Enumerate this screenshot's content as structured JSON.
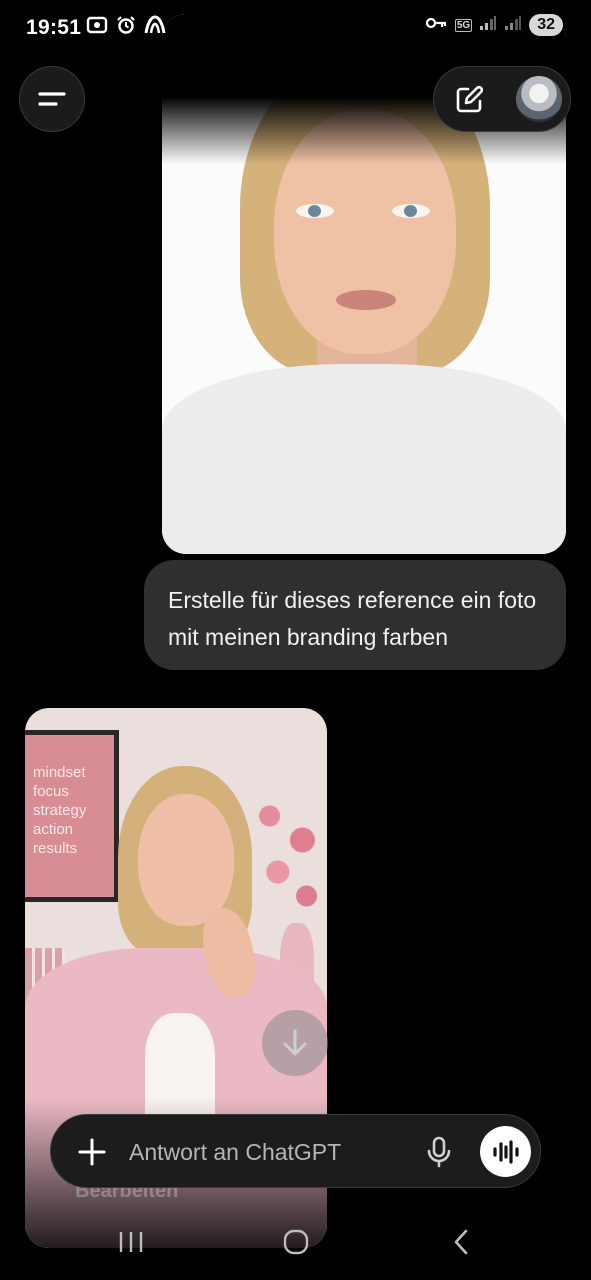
{
  "status_bar": {
    "time": "19:51",
    "network_label": "5G",
    "battery": "32",
    "left_icons": [
      "screen-recorder-icon",
      "alarm-icon",
      "app-notification-icon"
    ],
    "right_icons": [
      "vpn-key-icon",
      "network-5g-icon",
      "signal-icon",
      "signal-icon-2"
    ]
  },
  "header": {
    "menu_icon": "menu-icon",
    "edit_icon": "new-chat-icon",
    "avatar_icon": "robot-avatar"
  },
  "chat": {
    "user_message": "Erstelle für dieses reference ein foto mit meinen branding farben",
    "assistant_image_poster": [
      "mindset",
      "focus",
      "strategy",
      "action",
      "results"
    ],
    "assistant_image_overlay": "Bearbeiten"
  },
  "composer": {
    "placeholder": "Antwort an ChatGPT",
    "value": ""
  },
  "colors": {
    "background": "#000000",
    "bubble": "#2f2f2f",
    "accent_pink": "#e8b7c0"
  }
}
